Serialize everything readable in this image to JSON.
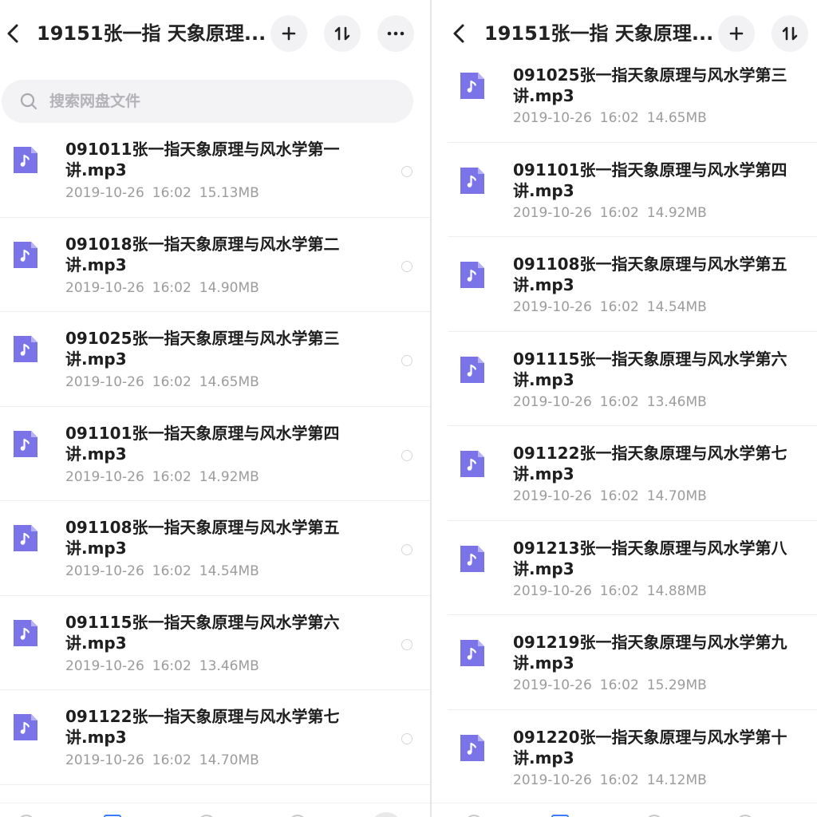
{
  "colors": {
    "accent": "#7b74e8",
    "meta_text": "#9c9c9c",
    "active_tab": "#3a7bff"
  },
  "left": {
    "header": {
      "title": "19151张一指 天象原理...",
      "back_icon": "chevron-left-icon",
      "add_icon": "plus-icon",
      "sort_icon": "sort-icon",
      "more_icon": "more-icon"
    },
    "search": {
      "placeholder": "搜索网盘文件"
    },
    "files": [
      {
        "name": "091011张一指天象原理与风水学第一讲.mp3",
        "date": "2019-10-26",
        "time": "16:02",
        "size": "15.13MB"
      },
      {
        "name": "091018张一指天象原理与风水学第二讲.mp3",
        "date": "2019-10-26",
        "time": "16:02",
        "size": "14.90MB"
      },
      {
        "name": "091025张一指天象原理与风水学第三讲.mp3",
        "date": "2019-10-26",
        "time": "16:02",
        "size": "14.65MB"
      },
      {
        "name": "091101张一指天象原理与风水学第四讲.mp3",
        "date": "2019-10-26",
        "time": "16:02",
        "size": "14.92MB"
      },
      {
        "name": "091108张一指天象原理与风水学第五讲.mp3",
        "date": "2019-10-26",
        "time": "16:02",
        "size": "14.54MB"
      },
      {
        "name": "091115张一指天象原理与风水学第六讲.mp3",
        "date": "2019-10-26",
        "time": "16:02",
        "size": "13.46MB"
      },
      {
        "name": "091122张一指天象原理与风水学第七讲.mp3",
        "date": "2019-10-26",
        "time": "16:02",
        "size": "14.70MB"
      }
    ]
  },
  "right": {
    "header": {
      "title": "19151张一指 天象原理...",
      "back_icon": "chevron-left-icon",
      "add_icon": "plus-icon",
      "sort_icon": "sort-icon"
    },
    "files": [
      {
        "name": "091025张一指天象原理与风水学第三讲.mp3",
        "date": "2019-10-26",
        "time": "16:02",
        "size": "14.65MB"
      },
      {
        "name": "091101张一指天象原理与风水学第四讲.mp3",
        "date": "2019-10-26",
        "time": "16:02",
        "size": "14.92MB"
      },
      {
        "name": "091108张一指天象原理与风水学第五讲.mp3",
        "date": "2019-10-26",
        "time": "16:02",
        "size": "14.54MB"
      },
      {
        "name": "091115张一指天象原理与风水学第六讲.mp3",
        "date": "2019-10-26",
        "time": "16:02",
        "size": "13.46MB"
      },
      {
        "name": "091122张一指天象原理与风水学第七讲.mp3",
        "date": "2019-10-26",
        "time": "16:02",
        "size": "14.70MB"
      },
      {
        "name": "091213张一指天象原理与风水学第八讲.mp3",
        "date": "2019-10-26",
        "time": "16:02",
        "size": "14.88MB"
      },
      {
        "name": "091219张一指天象原理与风水学第九讲.mp3",
        "date": "2019-10-26",
        "time": "16:02",
        "size": "15.29MB"
      },
      {
        "name": "091220张一指天象原理与风水学第十讲.mp3",
        "date": "2019-10-26",
        "time": "16:02",
        "size": "14.12MB"
      }
    ]
  }
}
